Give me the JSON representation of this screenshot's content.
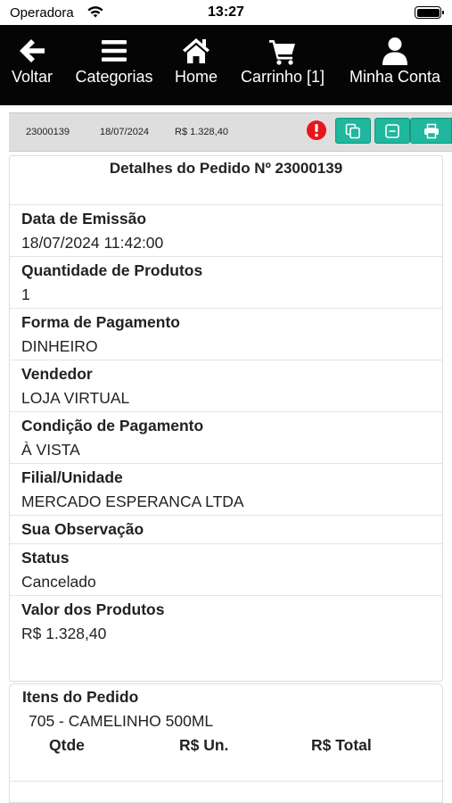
{
  "status_bar": {
    "carrier": "Operadora",
    "time": "13:27"
  },
  "nav": {
    "items": [
      {
        "label": "Voltar",
        "icon": "arrow-left-icon"
      },
      {
        "label": "Categorias",
        "icon": "menu-icon"
      },
      {
        "label": "Home",
        "icon": "home-icon"
      },
      {
        "label": "Carrinho [1]",
        "icon": "cart-icon"
      },
      {
        "label": "Minha Conta",
        "icon": "user-icon"
      }
    ]
  },
  "summary": {
    "order_number": "23000139",
    "date": "18/07/2024",
    "total": "R$ 1.328,40",
    "alert_color": "#e8151b",
    "button_color": "#1fb79e"
  },
  "details": {
    "title": "Detalhes do Pedido Nº 23000139",
    "fields": [
      {
        "label": "Data de Emissão",
        "value": "18/07/2024 11:42:00"
      },
      {
        "label": "Quantidade de Produtos",
        "value": "1"
      },
      {
        "label": "Forma de Pagamento",
        "value": "DINHEIRO"
      },
      {
        "label": "Vendedor",
        "value": "LOJA VIRTUAL"
      },
      {
        "label": "Condição de Pagamento",
        "value": "À VISTA"
      },
      {
        "label": "Filial/Unidade",
        "value": "MERCADO ESPERANCA LTDA"
      },
      {
        "label": "Sua Observação",
        "value": ""
      },
      {
        "label": "Status",
        "value": "Cancelado"
      },
      {
        "label": "Valor dos Produtos",
        "value": "R$ 1.328,40"
      }
    ]
  },
  "items": {
    "title": "Itens do Pedido",
    "product": "705 - CAMELINHO 500ML",
    "columns": [
      "Qtde",
      "R$ Un.",
      "R$ Total"
    ]
  }
}
